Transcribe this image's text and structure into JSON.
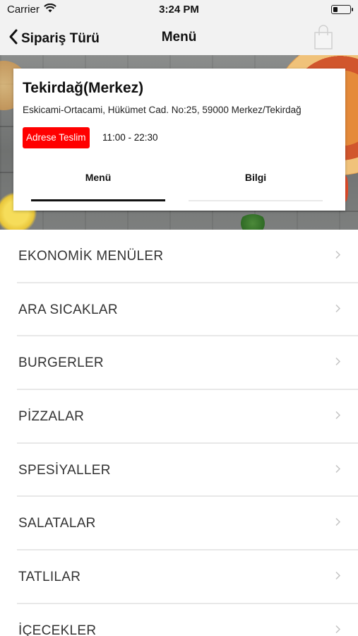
{
  "status_bar": {
    "carrier": "Carrier",
    "time": "3:24 PM"
  },
  "nav": {
    "back_label": "Sipariş Türü",
    "title": "Menü"
  },
  "store": {
    "name": "Tekirdağ(Merkez)",
    "address": "Eskicami-Ortacami, Hükümet Cad. No:25, 59000 Merkez/Tekirdağ",
    "delivery_badge": "Adrese Teslim",
    "hours": "11:00 - 22:30"
  },
  "tabs": [
    {
      "label": "Menü",
      "active": true
    },
    {
      "label": "Bilgi",
      "active": false
    }
  ],
  "categories": [
    "EKONOMİK MENÜLER",
    "ARA SICAKLAR",
    "BURGERLER",
    "PİZZALAR",
    "SPESİYALLER",
    "SALATALAR",
    "TATLILAR",
    "İÇECEKLER"
  ],
  "colors": {
    "accent": "#ff0000",
    "nav_bg": "#f2f2f2"
  },
  "icons": {
    "back": "chevron-left-icon",
    "cart": "shopping-bag-icon",
    "row": "chevron-right-icon"
  }
}
